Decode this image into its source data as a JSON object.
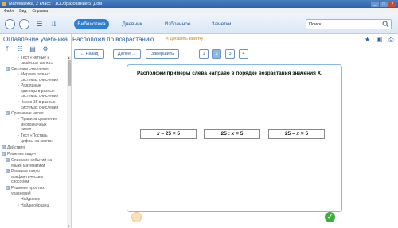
{
  "window": {
    "title": "Математика, 2 класс - 1СОбразование 5. Дом",
    "buttons": [
      "_",
      "□",
      "×"
    ]
  },
  "menu": [
    "Файл",
    "Вид",
    "Справка"
  ],
  "toolbar": {
    "back_icon": "left-arrow-icon",
    "forward_icon": "right-arrow-icon",
    "tabs": [
      {
        "label": "Библиотека",
        "active": true
      },
      {
        "label": "Дневник",
        "active": false
      },
      {
        "label": "Избранное",
        "active": false
      },
      {
        "label": "Заметки",
        "active": false
      }
    ],
    "search": {
      "placeholder": "Поиск"
    }
  },
  "sidebar": {
    "heading": "Оглавление учебника",
    "items": [
      {
        "label": "Тест «Чётные и",
        "level": 3
      },
      {
        "label": "нечётные числа»",
        "level": 3
      },
      {
        "label": "Системы счисления",
        "level": 1,
        "expander": "⊟"
      },
      {
        "label": "Мерки в разных",
        "level": 3
      },
      {
        "label": "системах счисления",
        "level": 3
      },
      {
        "label": "Разрядные",
        "level": 3
      },
      {
        "label": "единицы в разных",
        "level": 3
      },
      {
        "label": "системах счисления",
        "level": 3
      },
      {
        "label": "Число 15 в разных",
        "level": 3
      },
      {
        "label": "системах счисления",
        "level": 3
      },
      {
        "label": "Сравнение чисел",
        "level": 1,
        "expander": "⊟"
      },
      {
        "label": "Правила сравнения",
        "level": 3
      },
      {
        "label": "многозначных",
        "level": 3
      },
      {
        "label": "чисел",
        "level": 3
      },
      {
        "label": "Тест «Поставь",
        "level": 3
      },
      {
        "label": "цифры на места»",
        "level": 3
      },
      {
        "label": "Действия",
        "level": 0,
        "expander": "⊞"
      },
      {
        "label": "Решение задач",
        "level": 0,
        "expander": "⊟"
      },
      {
        "label": "Описание событий на",
        "level": 1,
        "expander": "⊞"
      },
      {
        "label": "языке математики",
        "level": 2
      },
      {
        "label": "Решение задач",
        "level": 1,
        "expander": "⊞"
      },
      {
        "label": "арифметическим",
        "level": 2
      },
      {
        "label": "способом",
        "level": 2
      },
      {
        "label": "Решение простых",
        "level": 1,
        "expander": "⊟"
      },
      {
        "label": "уравнений",
        "level": 2
      },
      {
        "label": "Найди икс",
        "level": 3
      },
      {
        "label": "Найди образец",
        "level": 3
      }
    ]
  },
  "main": {
    "title": "Расположи по возрастанию",
    "bookmark_label": "Добавить заметку",
    "controls": {
      "back": "← Назад",
      "next": "Далее →",
      "finish": "Завершить"
    },
    "pages": [
      "1",
      "2",
      "3",
      "4"
    ],
    "active_page": "2",
    "task": {
      "instruction": "Расположи примеры слева направо в порядке возрастания значения  X.",
      "expressions": [
        {
          "a": "x",
          "b": " – 25 = 5",
          "order": "var-first"
        },
        {
          "a": "25 : ",
          "b": "x",
          "c": " = 5",
          "order": "var-middle"
        },
        {
          "a": "25 – ",
          "b": "x",
          "c": " = 5",
          "order": "var-middle"
        }
      ]
    }
  },
  "colors": {
    "accent": "#2f7fd0",
    "title_blue": "#2d5f9e",
    "check_green": "#3cae3c",
    "prev_orange": "#fbe0b8"
  }
}
